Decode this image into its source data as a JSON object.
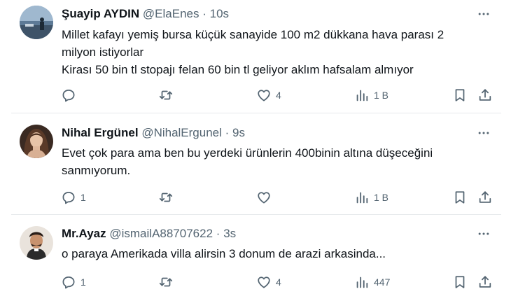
{
  "tweets": [
    {
      "name": "Şuayip AYDIN",
      "handle": "@ElaEnes",
      "dot": "·",
      "time": "10s",
      "lines": [
        "Millet kafayı yemiş bursa küçük sanayide 100 m2 dükkana hava parası 2",
        "milyon istiyorlar",
        "Kirası 50 bin tl stopajı felan 60 bin tl geliyor aklım hafsalam almıyor"
      ],
      "replies": "",
      "reposts": "",
      "likes": "4",
      "views": "1 B"
    },
    {
      "name": "Nihal Ergünel",
      "handle": "@NihalErgunel",
      "dot": "·",
      "time": "9s",
      "lines": [
        "Evet çok para ama ben bu yerdeki ürünlerin 400binin altına düşeceğini",
        "sanmıyorum."
      ],
      "replies": "1",
      "reposts": "",
      "likes": "",
      "views": "1 B"
    },
    {
      "name": "Mr.Ayaz",
      "handle": "@ismailA88707622",
      "dot": "·",
      "time": "3s",
      "lines": [
        "o paraya Amerikada villa alirsin 3 donum de arazi arkasinda..."
      ],
      "replies": "1",
      "reposts": "",
      "likes": "4",
      "views": "447"
    }
  ],
  "colors": {
    "text": "#0f1419",
    "muted": "#536471",
    "divider": "#e6e9ec"
  },
  "icons": [
    "reply-icon",
    "repost-icon",
    "like-icon",
    "views-icon",
    "bookmark-icon",
    "share-icon",
    "more-icon"
  ]
}
